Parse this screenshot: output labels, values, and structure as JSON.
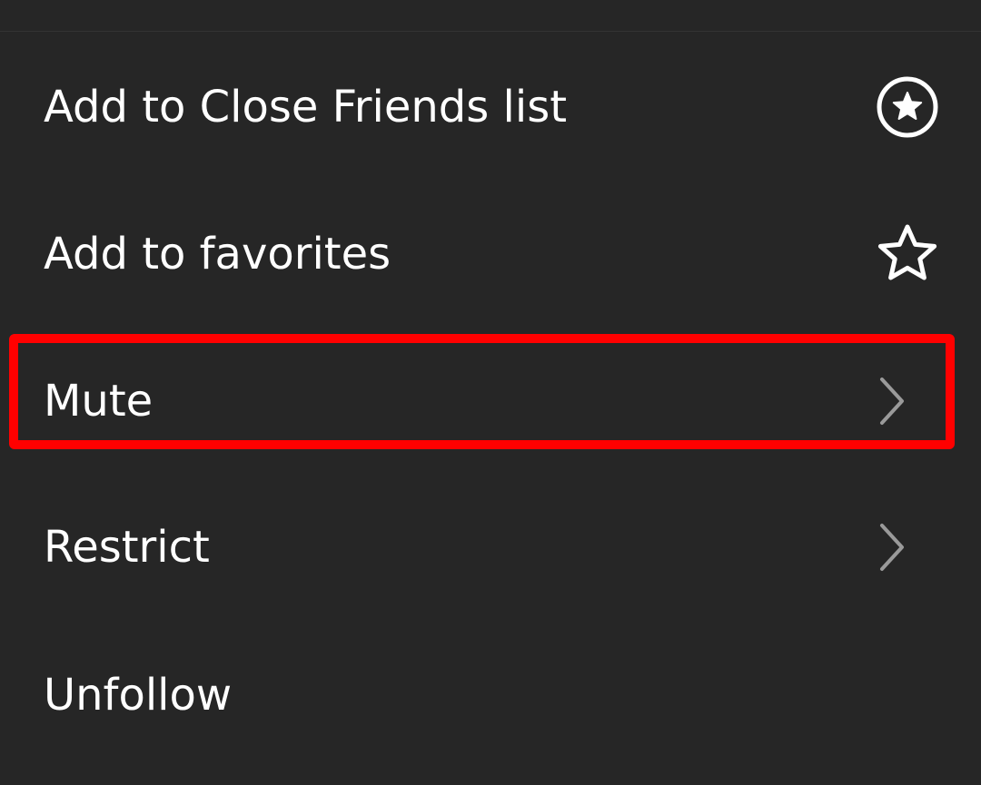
{
  "menu": {
    "items": [
      {
        "label": "Add to Close Friends list",
        "icon": "close-friends-star-circle-icon"
      },
      {
        "label": "Add to favorites",
        "icon": "star-outline-icon"
      },
      {
        "label": "Mute",
        "icon": "chevron-right-icon"
      },
      {
        "label": "Restrict",
        "icon": "chevron-right-icon"
      },
      {
        "label": "Unfollow",
        "icon": ""
      }
    ]
  },
  "annotation": {
    "highlighted_item": "Mute",
    "highlight_color": "#ff0000"
  },
  "colors": {
    "background": "#262626",
    "text": "#ffffff",
    "chevron": "#9a9a9a"
  }
}
